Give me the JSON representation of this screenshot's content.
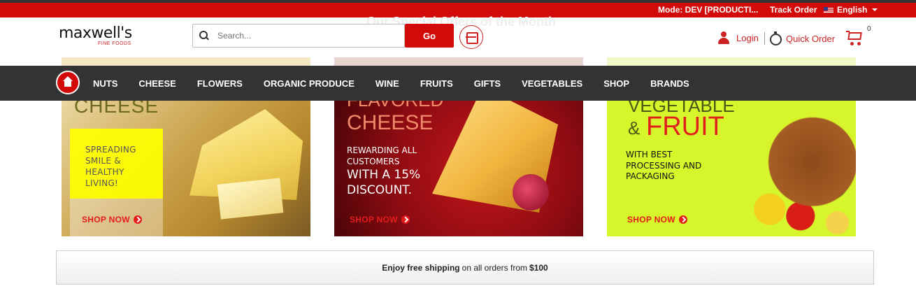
{
  "topbar": {
    "mode": "Mode: DEV [PRODUCTI...",
    "track_order": "Track Order",
    "language": "English"
  },
  "logo": {
    "name": "maxwell's",
    "tagline": "FINE FOODS"
  },
  "background_heading": "Our Special Offers of the Month",
  "search": {
    "placeholder": "Search...",
    "value": "",
    "go_label": "Go"
  },
  "account": {
    "login_label": "Login",
    "quick_order_label": "Quick Order",
    "cart_count": "0"
  },
  "nav": {
    "items": [
      {
        "label": "NUTS"
      },
      {
        "label": "CHEESE"
      },
      {
        "label": "FLOWERS"
      },
      {
        "label": "ORGANIC PRODUCE"
      },
      {
        "label": "WINE"
      },
      {
        "label": "FRUITS"
      },
      {
        "label": "GIFTS"
      },
      {
        "label": "VEGETABLES"
      },
      {
        "label": "SHOP"
      },
      {
        "label": "BRANDS"
      }
    ]
  },
  "banners": [
    {
      "heading": "CHEESE",
      "text": "SPREADING SMILE & HEALTHY LIVING!",
      "cta": "SHOP NOW"
    },
    {
      "heading_line1": "FLAVORED",
      "heading_line2": "CHEESE",
      "text1": "REWARDING ALL CUSTOMERS",
      "text2": "WITH A 15% DISCOUNT.",
      "cta": "SHOP NOW"
    },
    {
      "heading_line1": "VEGETABLE",
      "heading_amp": "&",
      "heading_line2": "FRUIT",
      "text": "WITH BEST PROCESSING AND PACKAGING",
      "cta": "SHOP NOW"
    }
  ],
  "shipping": {
    "part1": "Enjoy free shipping",
    "part2": "on all orders from",
    "part3": "$100"
  },
  "colors": {
    "brand_red": "#d20a0a",
    "nav_bg": "#333333",
    "link_red": "#c22222"
  }
}
